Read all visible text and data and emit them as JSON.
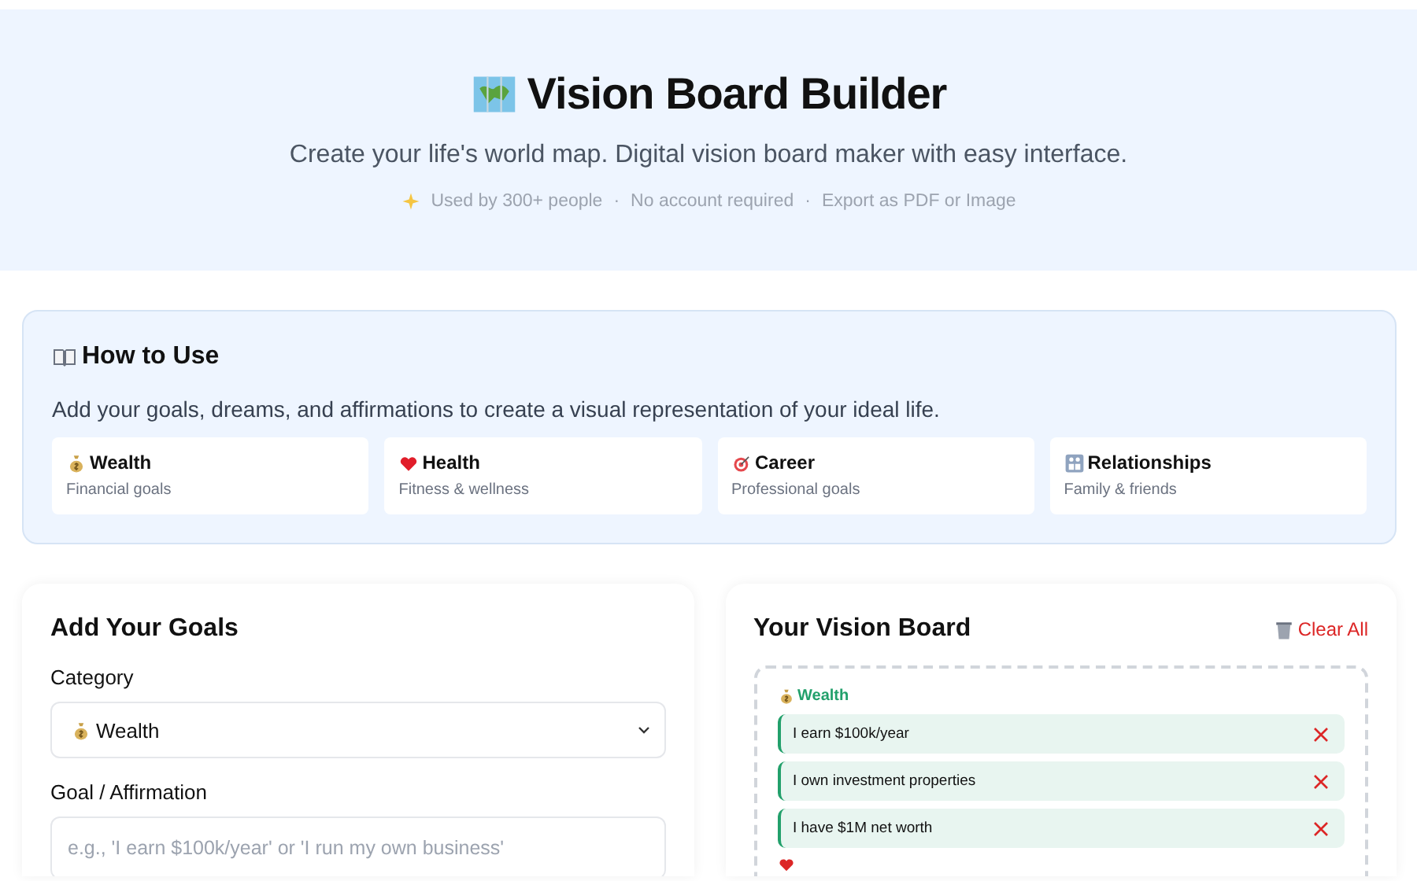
{
  "hero": {
    "title": "Vision Board Builder",
    "subtitle": "Create your life's world map. Digital vision board maker with easy interface.",
    "separator": "·",
    "facts": [
      "Used by 300+ people",
      "No account required",
      "Export as PDF or Image"
    ]
  },
  "how_to": {
    "title": "How to Use",
    "text": "Add your goals, dreams, and affirmations to create a visual representation of your ideal life.",
    "categories": [
      {
        "kind": "wealth",
        "name": "Wealth",
        "description": "Financial goals"
      },
      {
        "kind": "health",
        "name": "Health",
        "description": "Fitness & wellness"
      },
      {
        "kind": "career",
        "name": "Career",
        "description": "Professional goals"
      },
      {
        "kind": "relationships",
        "name": "Relationships",
        "description": "Family & friends"
      }
    ]
  },
  "add_goals": {
    "title": "Add Your Goals",
    "category_label": "Category",
    "category": {
      "kind": "wealth",
      "value": "Wealth"
    },
    "goal_label": "Goal / Affirmation",
    "goal_placeholder": "e.g., 'I earn $100k/year' or 'I run my own business'"
  },
  "board": {
    "title": "Your Vision Board",
    "clear_button": "Clear All",
    "groups": [
      {
        "kind": "wealth",
        "label": "Wealth",
        "color": "#22a06b",
        "items": [
          "I earn $100k/year",
          "I own investment properties",
          "I have $1M net worth"
        ]
      },
      {
        "kind": "health",
        "color": "#dc2626"
      }
    ]
  }
}
